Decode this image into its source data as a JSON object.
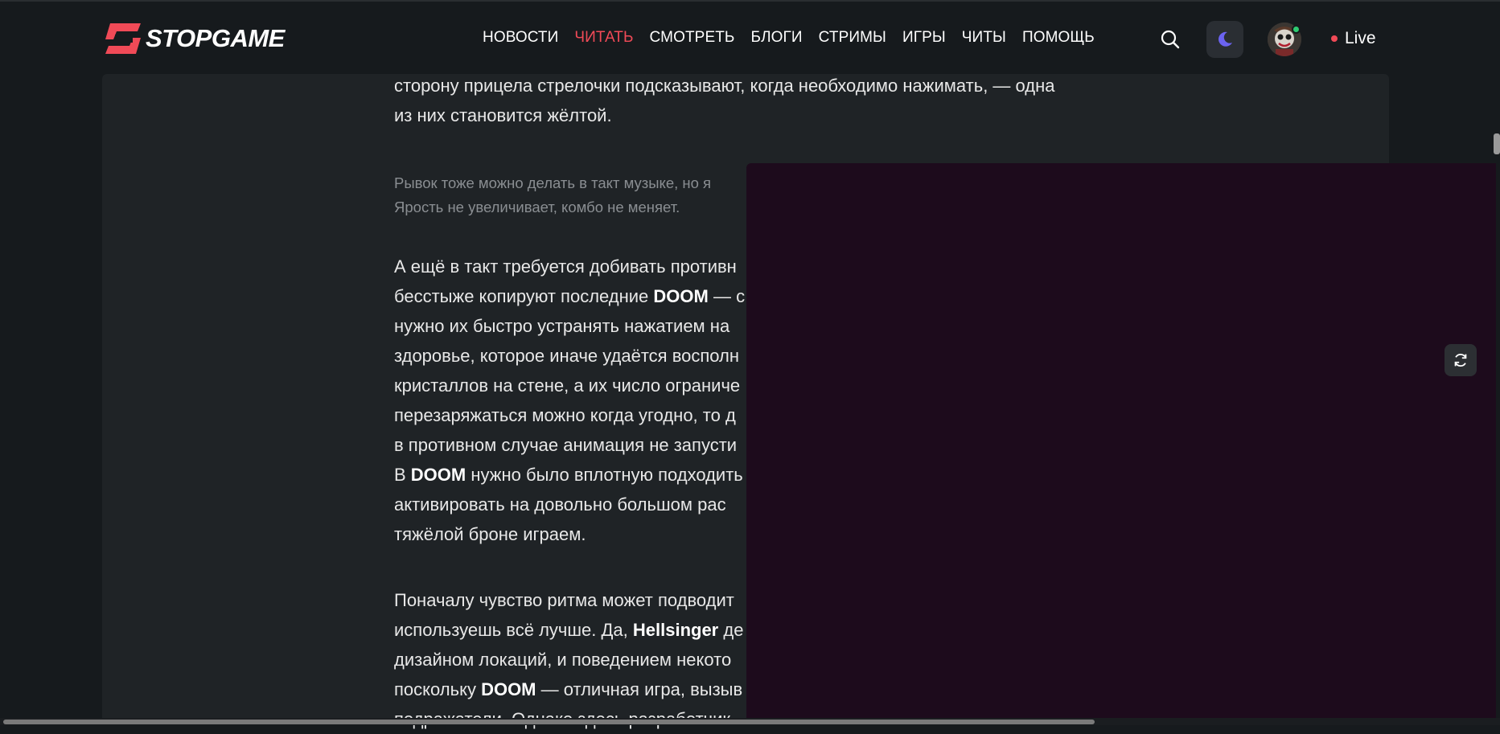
{
  "header": {
    "logo_text": "STOPGAME",
    "nav": [
      {
        "label": "НОВОСТИ",
        "active": false
      },
      {
        "label": "ЧИТАТЬ",
        "active": true
      },
      {
        "label": "СМОТРЕТЬ",
        "active": false
      },
      {
        "label": "БЛОГИ",
        "active": false
      },
      {
        "label": "СТРИМЫ",
        "active": false
      },
      {
        "label": "ИГРЫ",
        "active": false
      },
      {
        "label": "ЧИТЫ",
        "active": false
      },
      {
        "label": "ПОМОЩЬ",
        "active": false
      }
    ],
    "search_icon": "search-icon",
    "theme_icon": "moon-icon",
    "live_label": "Live"
  },
  "article": {
    "para0": [
      "сторону прицела стрелочки подсказывают, когда необходимо нажимать, — одна",
      "из них становится жёлтой."
    ],
    "caption": [
      "Рывок тоже можно делать в такт музыке, но я",
      "Ярость не увеличивает, комбо не меняет."
    ],
    "para1": [
      {
        "pre": "А ещё в такт требуется добивать противн",
        "bold": "",
        "post": ""
      },
      {
        "pre": "бесстыже копируют последние ",
        "bold": "DOOM",
        "post": " — с"
      },
      {
        "pre": "нужно их быстро устранять нажатием на",
        "bold": "",
        "post": ""
      },
      {
        "pre": "здоровье, которое иначе удаётся восполн",
        "bold": "",
        "post": ""
      },
      {
        "pre": "кристаллов на стене, а их число ограниче",
        "bold": "",
        "post": ""
      },
      {
        "pre": "перезаряжаться можно когда угодно, то д",
        "bold": "",
        "post": ""
      },
      {
        "pre": "в противном случае анимация не запусти",
        "bold": "",
        "post": ""
      },
      {
        "pre": "В ",
        "bold": "DOOM",
        "post": " нужно было вплотную подходить"
      },
      {
        "pre": "активировать на довольно большом рас",
        "bold": "",
        "post": ""
      },
      {
        "pre": "тяжёлой броне играем.",
        "bold": "",
        "post": ""
      }
    ],
    "para2": [
      {
        "pre": "Поначалу чувство ритма может подводит",
        "bold": "",
        "post": ""
      },
      {
        "pre": "используешь всё лучше. Да, ",
        "bold": "Hellsinger",
        "post": " де"
      },
      {
        "pre": "дизайном локаций, и поведением некото",
        "bold": "",
        "post": ""
      },
      {
        "pre": "поскольку ",
        "bold": "DOOM",
        "post": " — отличная игра, вызыв"
      },
      {
        "pre": "подражатели. Однако здесь разработчик",
        "bold": "",
        "post": ""
      }
    ]
  },
  "overlay": {
    "refresh_icon": "refresh-icon"
  },
  "colors": {
    "accent": "#f04a57",
    "background": "#161a1d",
    "panel": "#1f2326",
    "overlay": "#1d0b1c",
    "online": "#2ecc71",
    "moon": "#6b63f0"
  }
}
